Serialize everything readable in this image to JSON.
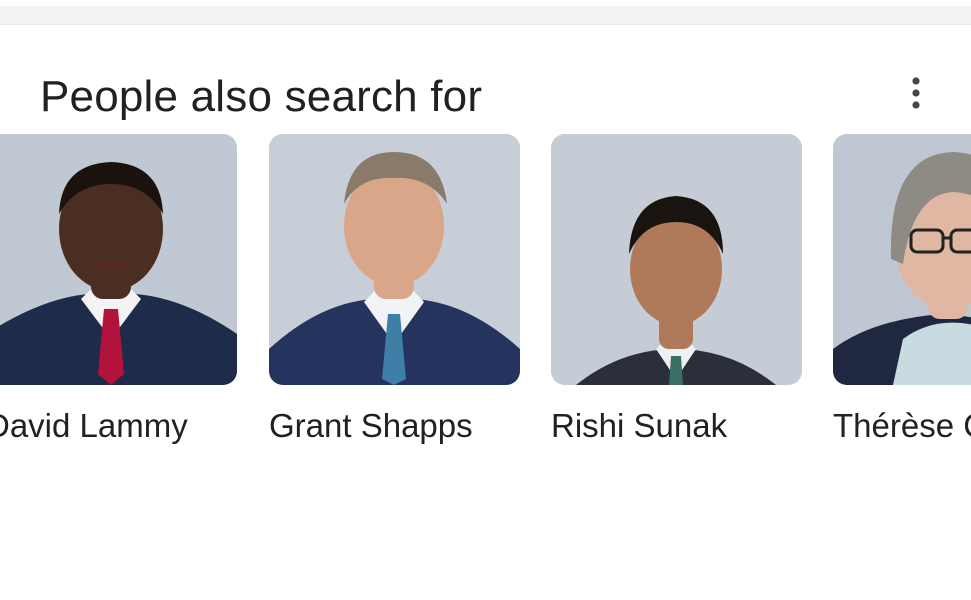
{
  "header": {
    "title": "People also search for",
    "more_icon": "more-vert-icon"
  },
  "people": [
    {
      "name": "David Lammy",
      "skin": "#4a2e22",
      "hair": "#1b120e",
      "suit": "#1f2b4a",
      "tie": "#b3123a",
      "bg": "#c0c8d3"
    },
    {
      "name": "Grant Shapps",
      "skin": "#d9a68a",
      "hair": "#8a7a6a",
      "suit": "#24345e",
      "tie": "#3f7ea6",
      "bg": "#c7ced8"
    },
    {
      "name": "Rishi Sunak",
      "skin": "#b07a5a",
      "hair": "#1a1411",
      "suit": "#2a2f3a",
      "tie": "#3a6f66",
      "bg": "#c5ccd6"
    },
    {
      "name": "Thérèse Coffey",
      "skin": "#e0b7a3",
      "hair": "#8e8a84",
      "suit": "#1f2840",
      "tie": "#c7dbe1",
      "bg": "#bfc7d2"
    }
  ]
}
